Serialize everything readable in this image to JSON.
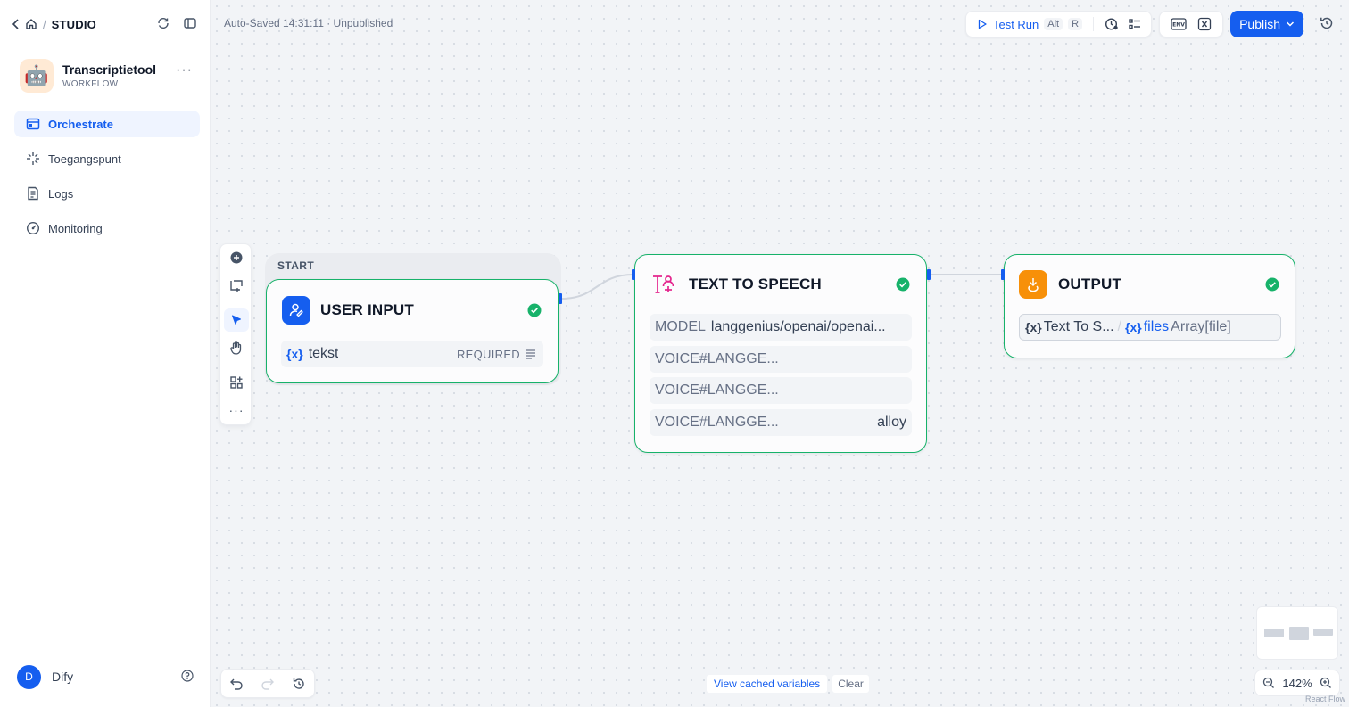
{
  "breadcrumb": {
    "separator": "/",
    "section": "STUDIO"
  },
  "app": {
    "name": "Transcriptietool",
    "kind": "WORKFLOW",
    "avatar_glyph": "🤖"
  },
  "nav": [
    {
      "label": "Orchestrate",
      "icon": "workflow-icon",
      "active": true
    },
    {
      "label": "Toegangspunt",
      "icon": "access-point-icon",
      "active": false
    },
    {
      "label": "Logs",
      "icon": "logs-icon",
      "active": false
    },
    {
      "label": "Monitoring",
      "icon": "monitoring-icon",
      "active": false
    }
  ],
  "user": {
    "initial": "D",
    "name": "Dify"
  },
  "status": {
    "autosave": "Auto-Saved 14:31:11 · Unpublished"
  },
  "toolbar": {
    "test_run_label": "Test Run",
    "test_run_key1": "Alt",
    "test_run_key2": "R",
    "publish_label": "Publish"
  },
  "nodes": {
    "start": {
      "group_label": "START",
      "title": "USER INPUT",
      "var_name": "tekst",
      "var_badge": "REQUIRED"
    },
    "tts": {
      "title": "TEXT TO SPEECH",
      "rows": [
        {
          "key": "MODEL",
          "value": "langgenius/openai/openai..."
        },
        {
          "key": "VOICE#LANGGE...",
          "value": ""
        },
        {
          "key": "VOICE#LANGGE...",
          "value": ""
        },
        {
          "key": "VOICE#LANGGE...",
          "value": "alloy"
        }
      ]
    },
    "output": {
      "title": "OUTPUT",
      "source": "Text To S...",
      "separator": "/",
      "var": "files",
      "type": "Array[file]"
    }
  },
  "bottom": {
    "view_cached": "View cached variables",
    "clear": "Clear",
    "zoom": "142%",
    "attribution": "React Flow"
  },
  "colors": {
    "accent": "#155eef",
    "success": "#17b26a",
    "tts_icon": "#e4258d",
    "output_icon": "#f79009"
  },
  "var_prefix": "{x}"
}
